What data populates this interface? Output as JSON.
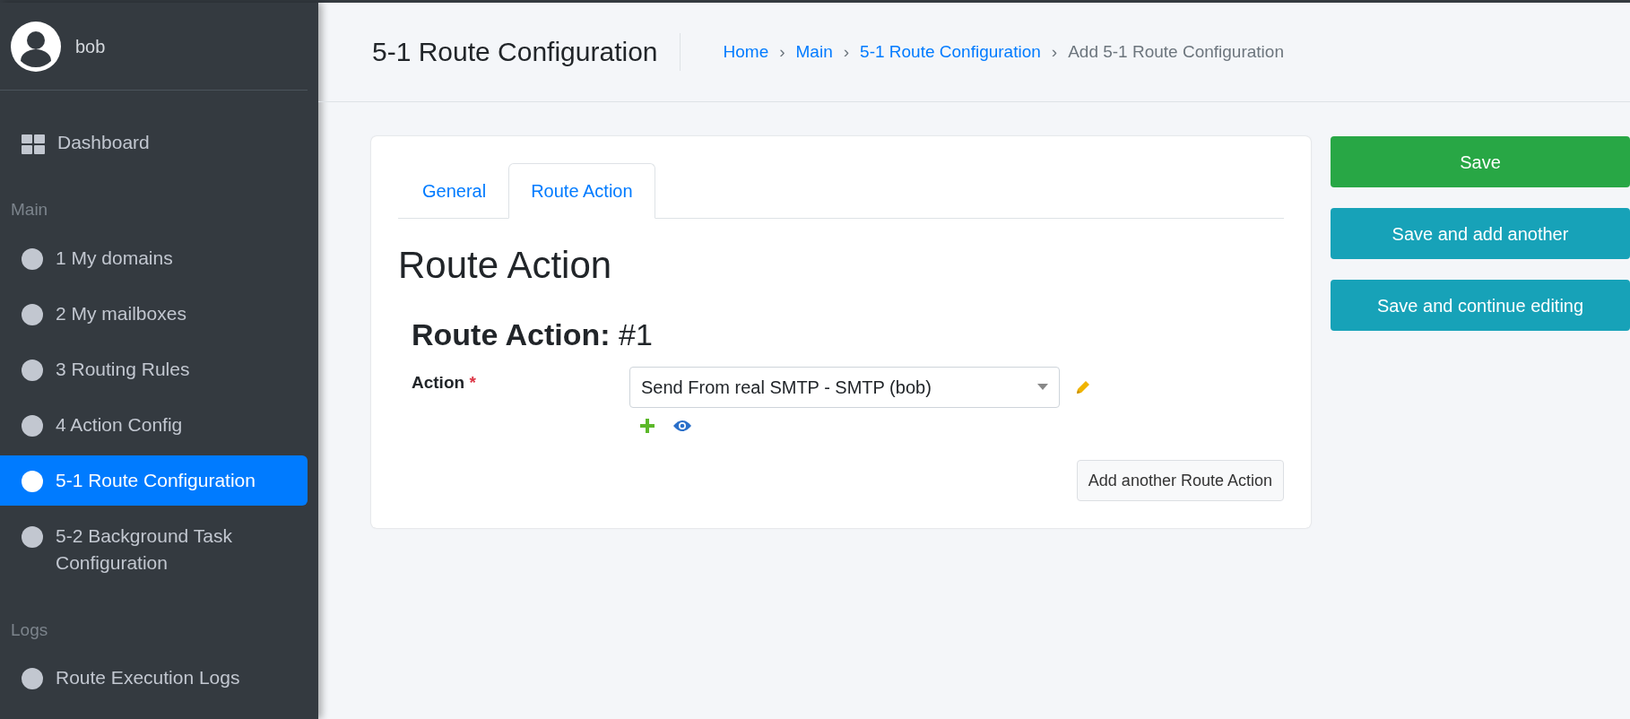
{
  "user": {
    "name": "bob"
  },
  "sidebar": {
    "items": [
      {
        "label": "Dashboard",
        "kind": "dashboard",
        "selected": false
      },
      {
        "label": "Main",
        "kind": "header"
      },
      {
        "label": "1 My domains",
        "kind": "link",
        "selected": false
      },
      {
        "label": "2 My mailboxes",
        "kind": "link",
        "selected": false
      },
      {
        "label": "3 Routing Rules",
        "kind": "link",
        "selected": false
      },
      {
        "label": "4 Action Config",
        "kind": "link",
        "selected": false
      },
      {
        "label": "5-1 Route Configuration",
        "kind": "link",
        "selected": true
      },
      {
        "label": "5-2 Background Task Configuration",
        "kind": "link",
        "selected": false
      },
      {
        "label": "Logs",
        "kind": "header"
      },
      {
        "label": "Route Execution Logs",
        "kind": "link",
        "selected": false
      }
    ]
  },
  "page_title": "5-1 Route Configuration",
  "breadcrumb": [
    {
      "label": "Home",
      "link": true
    },
    {
      "label": "Main",
      "link": true
    },
    {
      "label": "5-1 Route Configuration",
      "link": true
    },
    {
      "label": "Add 5-1 Route Configuration",
      "link": false
    }
  ],
  "breadcrumb_separator": "›",
  "tabs": [
    {
      "label": "General",
      "selected": false
    },
    {
      "label": "Route Action",
      "selected": true
    }
  ],
  "section_title": "Route Action",
  "inline": {
    "title_bold": "Route Action:",
    "title_number": "#1",
    "field_label": "Action",
    "required_mark": "*",
    "value": "Send From real SMTP - SMTP (bob)"
  },
  "add_button": "Add another Route Action",
  "actions": [
    {
      "label": "Save",
      "kind": "primary"
    },
    {
      "label": "Save and add another",
      "kind": "secondary"
    },
    {
      "label": "Save and continue editing",
      "kind": "secondary"
    }
  ]
}
